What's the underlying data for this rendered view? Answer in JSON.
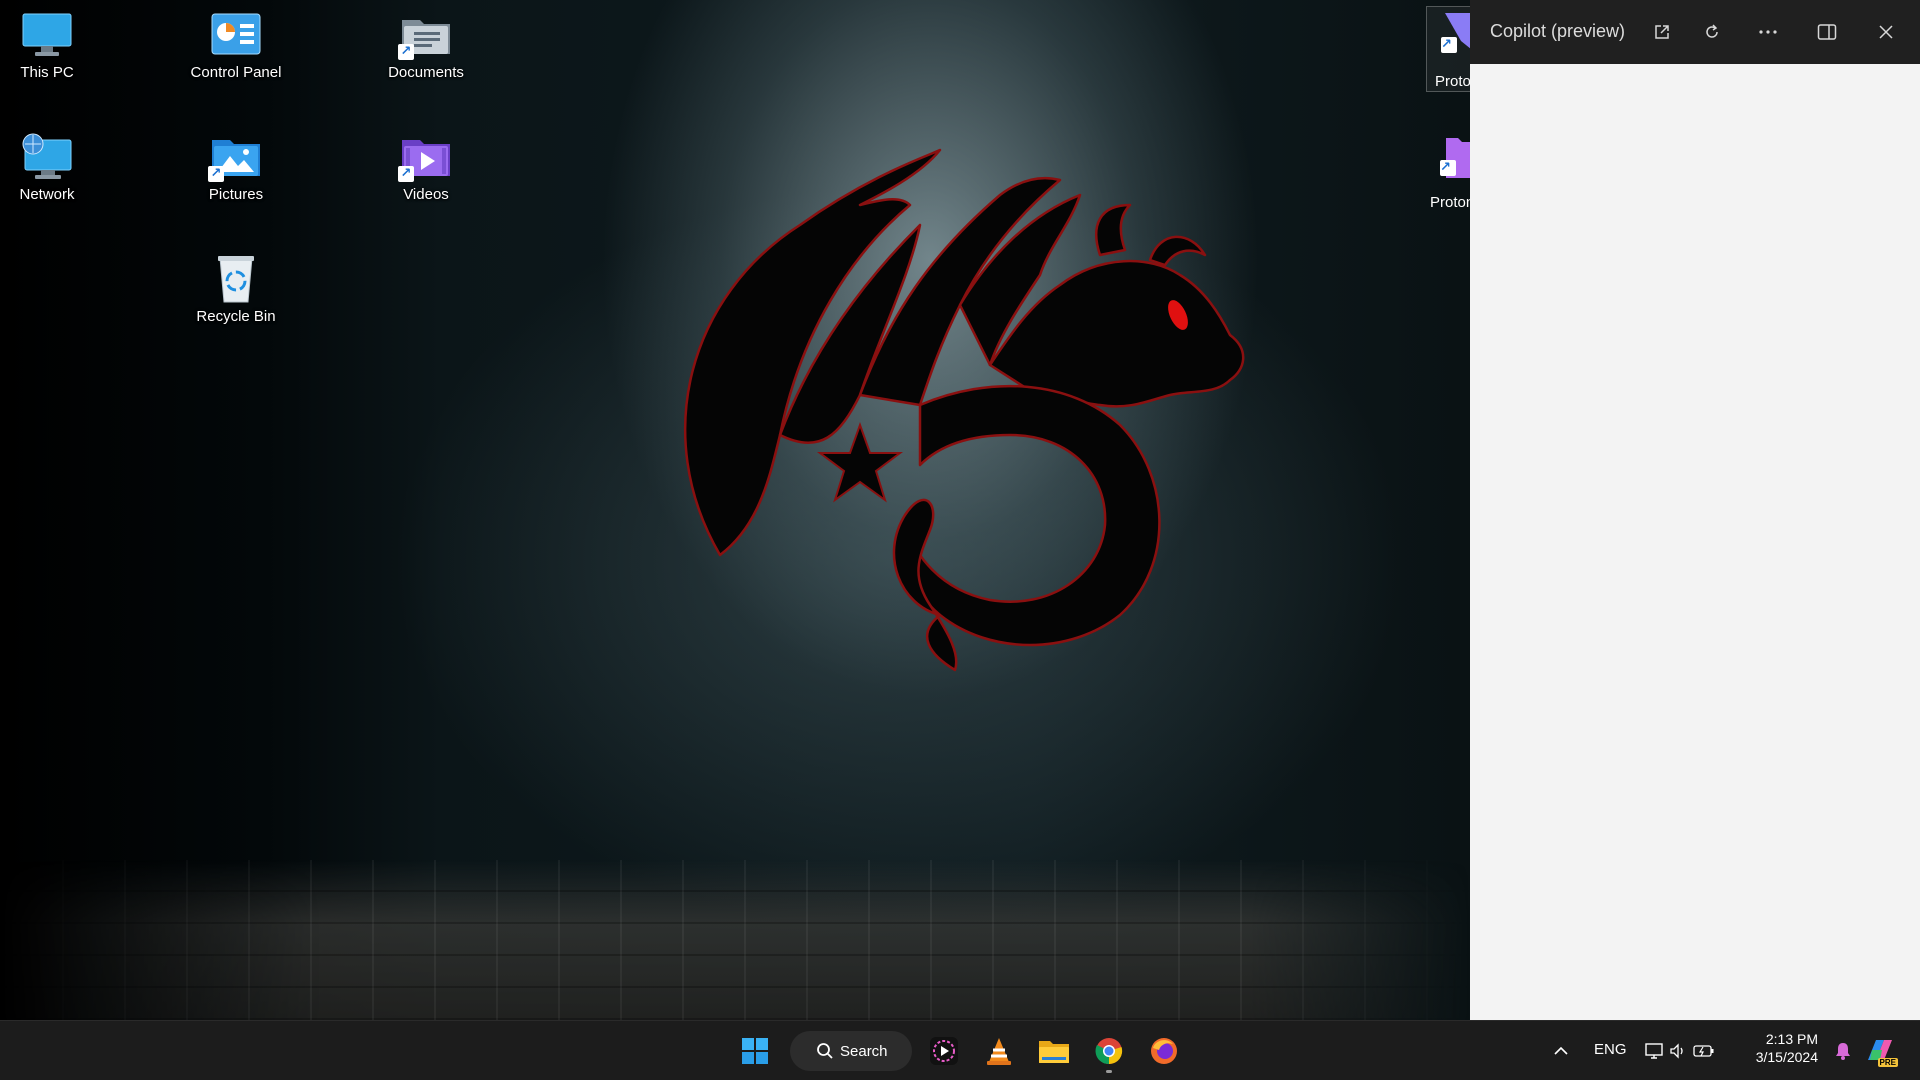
{
  "desktop": {
    "icons": [
      {
        "label": "This PC",
        "icon": "monitor-icon"
      },
      {
        "label": "Control Panel",
        "icon": "control-panel-icon"
      },
      {
        "label": "Documents",
        "icon": "documents-folder-icon"
      },
      {
        "label": "Network",
        "icon": "network-icon"
      },
      {
        "label": "Pictures",
        "icon": "pictures-folder-icon"
      },
      {
        "label": "Videos",
        "icon": "videos-folder-icon"
      },
      {
        "label": "Recycle Bin",
        "icon": "recycle-bin-icon"
      },
      {
        "label": "Proto",
        "icon": "proton-app-icon"
      },
      {
        "label": "Proton",
        "icon": "proton-app-icon"
      }
    ]
  },
  "copilot": {
    "title": "Copilot (preview)",
    "buttons": [
      "open-in-new-icon",
      "refresh-icon",
      "more-icon",
      "dock-panel-icon",
      "close-icon"
    ]
  },
  "taskbar": {
    "search_label": "Search",
    "apps": [
      "windows-start-icon",
      "media-player-icon",
      "vlc-icon",
      "file-explorer-icon",
      "chrome-icon",
      "firefox-icon"
    ],
    "tray": {
      "language": "ENG",
      "time": "2:13 PM",
      "date": "3/15/2024",
      "copilot_badge": "PRE"
    }
  },
  "colors": {
    "taskbar_bg": "#1c1c1c",
    "copilot_header": "#202020",
    "copilot_body": "#f3f3f3",
    "dragon_eye": "#e01010"
  }
}
